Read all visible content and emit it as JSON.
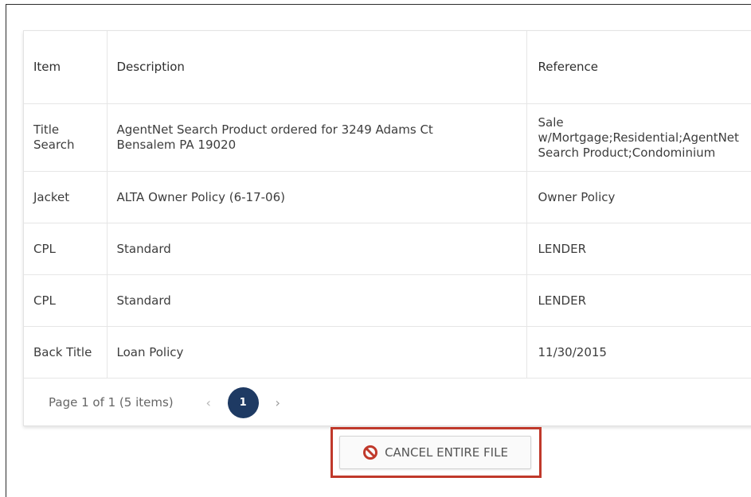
{
  "table": {
    "headers": {
      "item": "Item",
      "description": "Description",
      "reference": "Reference"
    },
    "rows": [
      {
        "item": "Title\nSearch",
        "description": "AgentNet Search Product ordered for 3249 Adams Ct\nBensalem PA 19020",
        "reference": "Sale\nw/Mortgage;Residential;AgentNet\nSearch Product;Condominium"
      },
      {
        "item": "Jacket",
        "description": "ALTA Owner Policy (6-17-06)",
        "reference": "Owner Policy"
      },
      {
        "item": "CPL",
        "description": "Standard",
        "reference": "LENDER"
      },
      {
        "item": "CPL",
        "description": "Standard",
        "reference": "LENDER"
      },
      {
        "item": "Back Title",
        "description": "Loan Policy",
        "reference": "11/30/2015"
      }
    ]
  },
  "pager": {
    "info": "Page 1 of 1 (5 items)",
    "current_page": "1",
    "prev_icon": "chevron-left-icon",
    "next_icon": "chevron-right-icon"
  },
  "cancel_button": {
    "label": "CANCEL ENTIRE FILE",
    "icon": "cancel-icon",
    "icon_color": "#c0392b"
  },
  "colors": {
    "page_badge": "#1e3a63",
    "highlight_border": "#c0392b"
  }
}
